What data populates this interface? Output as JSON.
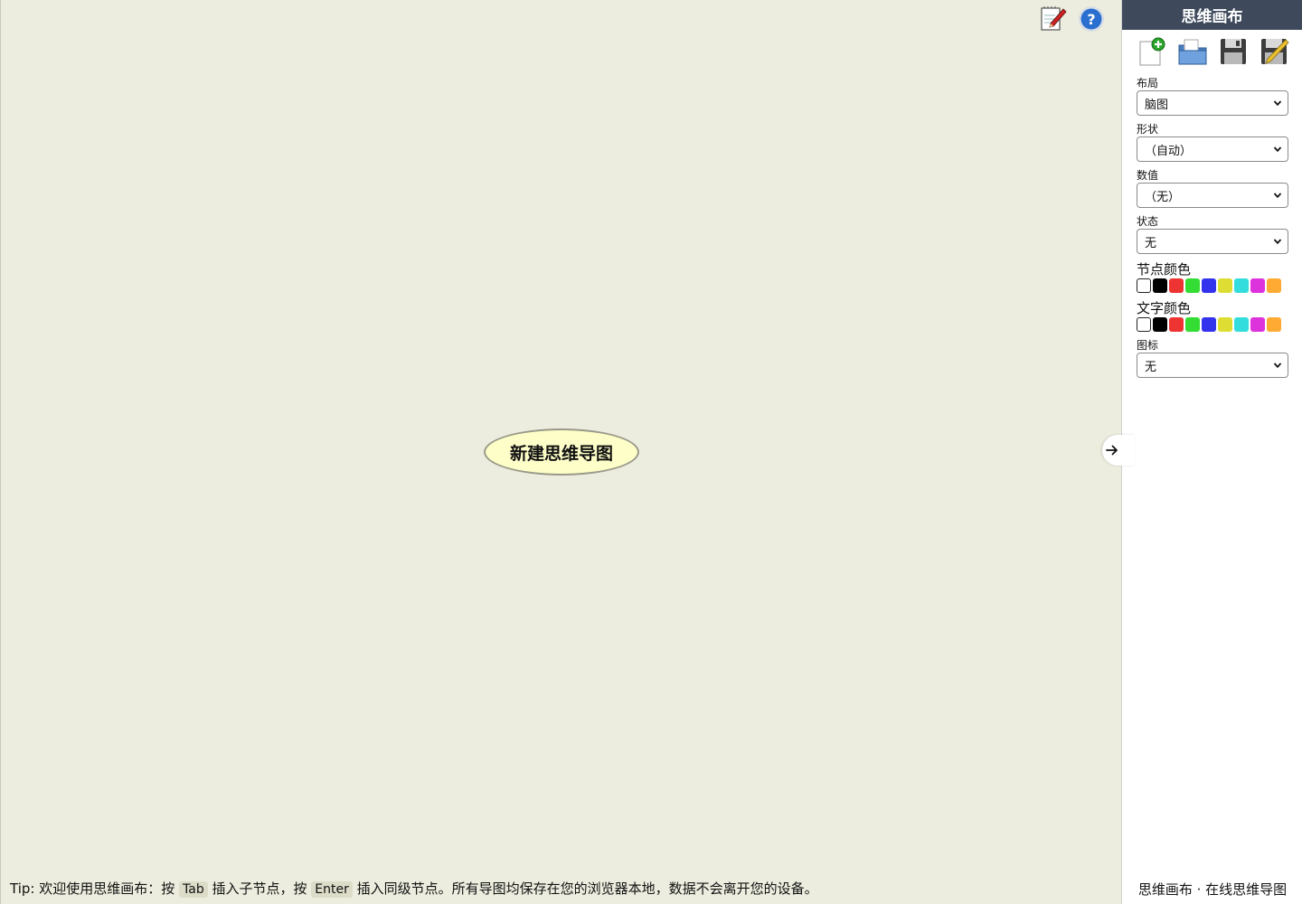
{
  "canvas": {
    "root_node": "新建思维导图"
  },
  "top_tools": [
    {
      "icon": "edit-notes-icon"
    },
    {
      "icon": "help-icon"
    }
  ],
  "tip": {
    "prefix": "Tip: 欢迎使用思维画布：按",
    "key1": "Tab",
    "mid": "插入子节点，按",
    "key2": "Enter",
    "suffix": "插入同级节点。所有导图均保存在您的浏览器本地，数据不会离开您的设备。"
  },
  "sidebar": {
    "title": "思维画布",
    "file_tools": [
      {
        "icon": "new-document-icon"
      },
      {
        "icon": "open-folder-icon"
      },
      {
        "icon": "save-disk-icon"
      },
      {
        "icon": "save-as-icon"
      }
    ],
    "layout": {
      "label": "布局",
      "value": "脑图"
    },
    "shape": {
      "label": "形状",
      "value": "（自动）"
    },
    "value": {
      "label": "数值",
      "value": "（无）"
    },
    "status": {
      "label": "状态",
      "value": "无"
    },
    "node_color": {
      "label": "节点颜色"
    },
    "text_color": {
      "label": "文字颜色"
    },
    "icon": {
      "label": "图标",
      "value": "无"
    },
    "footer": "思维画布 · 在线思维导图"
  },
  "colors": {
    "palette": [
      "#000000",
      "#ee3333",
      "#33dd33",
      "#3333ee",
      "#dddd33",
      "#33dddd",
      "#dd33dd",
      "#ffaa33"
    ],
    "header_bg": "#3e4a5c",
    "canvas_bg": "#ecedde",
    "node_fill": "#fefec8"
  }
}
